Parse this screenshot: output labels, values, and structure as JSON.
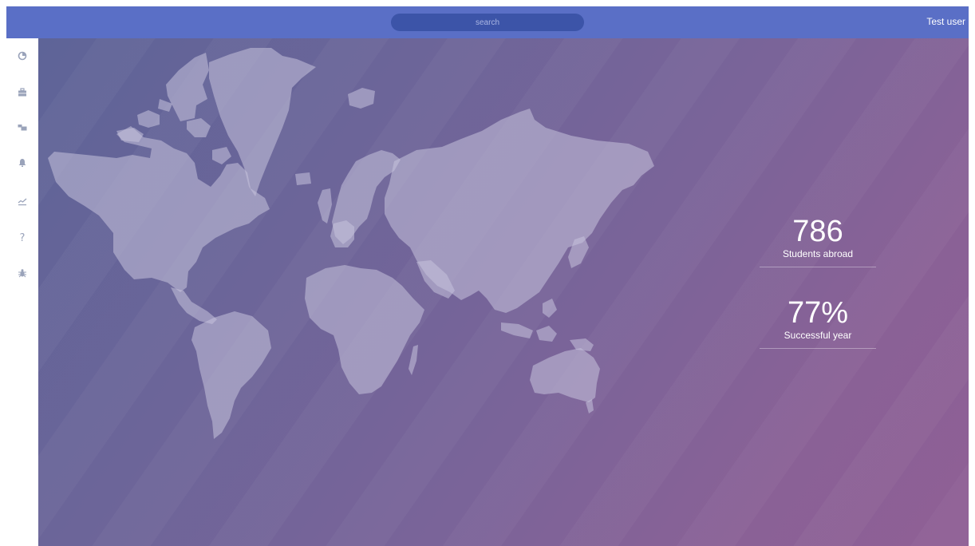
{
  "header": {
    "search_placeholder": "search",
    "user_name": "Test user"
  },
  "sidebar": {
    "items": [
      {
        "icon": "pie-chart-icon"
      },
      {
        "icon": "briefcase-icon"
      },
      {
        "icon": "chat-icon"
      },
      {
        "icon": "bell-icon"
      },
      {
        "icon": "trend-chart-icon"
      },
      {
        "icon": "question-icon",
        "glyph": "?"
      },
      {
        "icon": "bug-icon"
      }
    ]
  },
  "stats": [
    {
      "value": "786",
      "label": "Students abroad"
    },
    {
      "value": "77%",
      "label": "Successful year"
    }
  ],
  "colors": {
    "topbar": "#5a6fc6",
    "search_bg": "#3c54a8",
    "sidebar_icon": "#9aa3ba",
    "map_land": "#c7c3dc"
  }
}
